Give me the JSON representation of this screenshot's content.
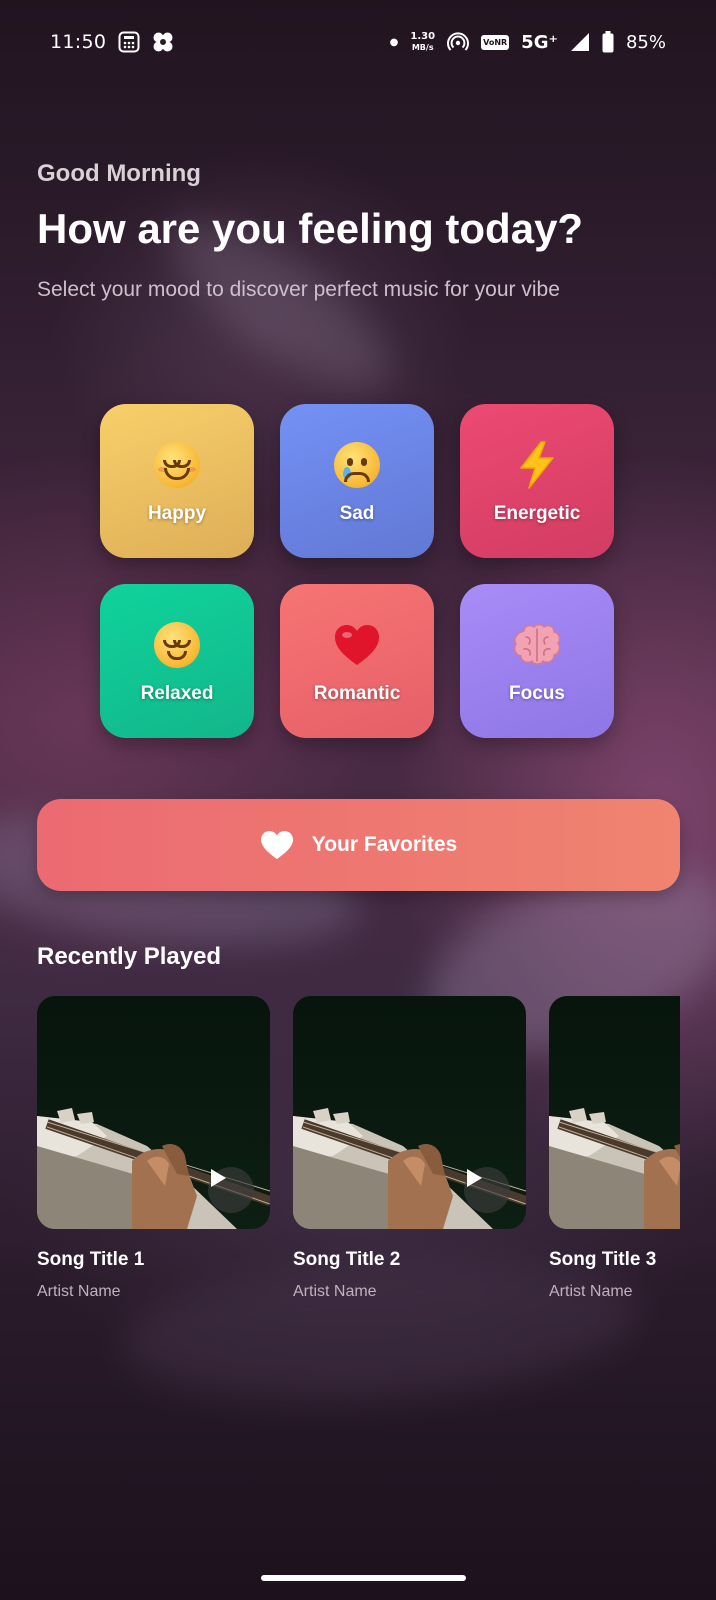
{
  "status_bar": {
    "time": "11:50",
    "net_speed_value": "1.30",
    "net_speed_unit": "MB/s",
    "vonr": "VoNR",
    "network": "5G⁺",
    "battery": "85%"
  },
  "header": {
    "greeting": "Good Morning",
    "headline": "How are you feeling today?",
    "subtitle": "Select your mood to discover perfect music for your vibe"
  },
  "moods": [
    {
      "label": "Happy",
      "icon": "smiling-face-icon",
      "color_from": "#f8cf6a",
      "color_to": "#deae57"
    },
    {
      "label": "Sad",
      "icon": "crying-face-icon",
      "color_from": "#7391f5",
      "color_to": "#6278d4"
    },
    {
      "label": "Energetic",
      "icon": "lightning-icon",
      "color_from": "#ec4a72",
      "color_to": "#d23c63"
    },
    {
      "label": "Relaxed",
      "icon": "relieved-face-icon",
      "color_from": "#10d39c",
      "color_to": "#12b68a"
    },
    {
      "label": "Romantic",
      "icon": "heart-icon",
      "color_from": "#f77474",
      "color_to": "#e56067"
    },
    {
      "label": "Focus",
      "icon": "brain-icon",
      "color_from": "#a88cf7",
      "color_to": "#8e76e6"
    }
  ],
  "favorites": {
    "label": "Your Favorites",
    "icon": "heart-icon"
  },
  "recently_played": {
    "title": "Recently Played",
    "songs": [
      {
        "title": "Song Title 1",
        "artist": "Artist Name"
      },
      {
        "title": "Song Title 2",
        "artist": "Artist Name"
      },
      {
        "title": "Song Title 3",
        "artist": "Artist Name"
      }
    ]
  }
}
